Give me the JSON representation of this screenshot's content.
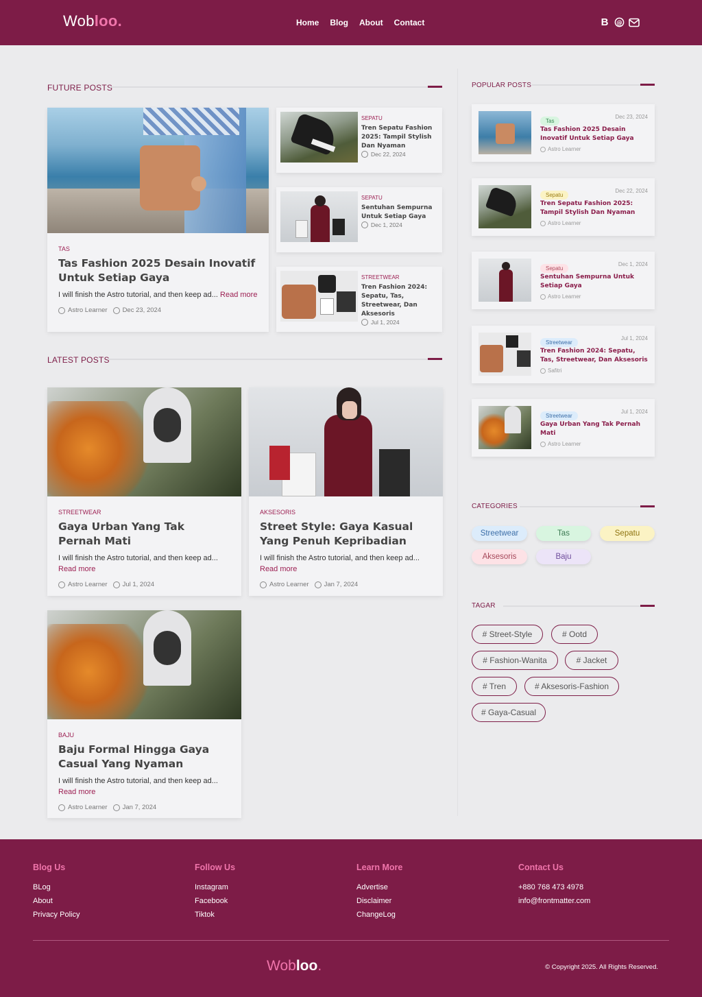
{
  "header": {
    "logo_main": "Wob",
    "logo_accent": "loo",
    "logo_dot": ".",
    "nav": [
      "Home",
      "Blog",
      "About",
      "Contact"
    ],
    "icons": [
      "blogger-icon",
      "threads-icon",
      "mail-icon"
    ]
  },
  "future": {
    "title": "FUTURE POSTS",
    "main": {
      "category": "TAS",
      "title": "Tas Fashion 2025 Desain Inovatif Untuk Setiap Gaya",
      "excerpt": "I will finish the Astro tutorial, and then keep ad...",
      "read_more": "Read more",
      "author": "Astro Learner",
      "date": "Dec 23, 2024"
    },
    "side": [
      {
        "category": "SEPATU",
        "title": "Tren Sepatu Fashion 2025: Tampil Stylish Dan Nyaman",
        "date": "Dec 22, 2024"
      },
      {
        "category": "SEPATU",
        "title": "Sentuhan Sempurna Untuk Setiap Gaya",
        "date": "Dec 1, 2024"
      },
      {
        "category": "STREETWEAR",
        "title": "Tren Fashion 2024: Sepatu, Tas, Streetwear, Dan Aksesoris",
        "date": "Jul 1, 2024"
      }
    ]
  },
  "latest": {
    "title": "LATEST POSTS",
    "posts": [
      {
        "category": "STREETWEAR",
        "title": "Gaya Urban Yang Tak Pernah Mati",
        "excerpt": "I will finish the Astro tutorial, and then keep ad...",
        "read_more": "Read more",
        "author": "Astro Learner",
        "date": "Jul 1, 2024"
      },
      {
        "category": "AKSESORIS",
        "title": "Street Style: Gaya Kasual Yang Penuh Kepribadian",
        "excerpt": "I will finish the Astro tutorial, and then keep ad...",
        "read_more": "Read more",
        "author": "Astro Learner",
        "date": "Jan 7, 2024"
      },
      {
        "category": "BAJU",
        "title": "Baju Formal Hingga Gaya Casual Yang Nyaman",
        "excerpt": "I will finish the Astro tutorial, and then keep ad...",
        "read_more": "Read more",
        "author": "Astro Learner",
        "date": "Jan 7, 2024"
      }
    ]
  },
  "popular": {
    "title": "POPULAR POSTS",
    "posts": [
      {
        "badge": "Tas",
        "date": "Dec 23, 2024",
        "title": "Tas Fashion 2025 Desain Inovatif Untuk Setiap Gaya",
        "author": "Astro Learner"
      },
      {
        "badge": "Sepatu",
        "date": "Dec 22, 2024",
        "title": "Tren Sepatu Fashion 2025: Tampil Stylish Dan Nyaman",
        "author": "Astro Learner"
      },
      {
        "badge": "Sepatu",
        "date": "Dec 1, 2024",
        "title": "Sentuhan Sempurna Untuk Setiap Gaya",
        "author": "Astro Learner"
      },
      {
        "badge": "Streetwear",
        "date": "Jul 1, 2024",
        "title": "Tren Fashion 2024: Sepatu, Tas, Streetwear, Dan Aksesoris",
        "author": "Safitri"
      },
      {
        "badge": "Streetwear",
        "date": "Jul 1, 2024",
        "title": "Gaya Urban Yang Tak Pernah Mati",
        "author": "Astro Learner"
      }
    ]
  },
  "categories": {
    "title": "CATEGORIES",
    "items": [
      "Streetwear",
      "Tas",
      "Sepatu",
      "Aksesoris",
      "Baju"
    ]
  },
  "tags": {
    "title": "TAGAR",
    "items": [
      "# Street-Style",
      "# Ootd",
      "# Fashion-Wanita",
      "# Jacket",
      "# Tren",
      "# Aksesoris-Fashion",
      "# Gaya-Casual"
    ]
  },
  "footer": {
    "columns": [
      {
        "title": "Blog Us",
        "links": [
          "BLog",
          "About",
          "Privacy Policy"
        ]
      },
      {
        "title": "Follow Us",
        "links": [
          "Instagram",
          "Facebook",
          "Tiktok"
        ]
      },
      {
        "title": "Learn More",
        "links": [
          "Advertise",
          "Disclaimer",
          "ChangeLog"
        ]
      },
      {
        "title": "Contact Us",
        "links": [
          "+880 768 473 4978",
          "info@frontmatter.com"
        ]
      }
    ],
    "logo_main": "Wob",
    "logo_bold": "loo",
    "logo_dot": ".",
    "copyright": "© Copyright 2025. All Rights Reserved."
  },
  "colors": {
    "brand": "#7d1c47",
    "accent_pink": "#f075ab"
  }
}
